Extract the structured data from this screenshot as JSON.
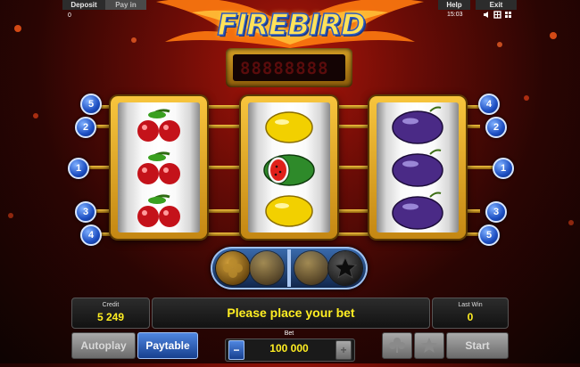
{
  "topbar": {
    "deposit_label": "Deposit",
    "payin_label": "Pay in",
    "deposit_value": "0",
    "help_label": "Help",
    "exit_label": "Exit",
    "time": "15:03"
  },
  "logo": {
    "title": "FIREBIRD"
  },
  "display": {
    "digits": "88888888"
  },
  "lines": {
    "left": [
      "5",
      "2",
      "1",
      "3",
      "4"
    ],
    "right": [
      "4",
      "2",
      "1",
      "3",
      "5"
    ]
  },
  "reels": [
    [
      "cherries",
      "cherries",
      "cherries"
    ],
    [
      "lemon",
      "watermelon",
      "lemon"
    ],
    [
      "plum",
      "plum",
      "plum"
    ]
  ],
  "credit": {
    "label": "Credit",
    "value": "5 249"
  },
  "message": "Please place your bet",
  "last_win": {
    "label": "Last Win",
    "value": "0"
  },
  "buttons": {
    "autoplay": "Autoplay",
    "paytable": "Paytable",
    "start": "Start"
  },
  "bet": {
    "label": "Bet",
    "value": "100 000",
    "minus": "−",
    "plus": "+"
  },
  "icons": {
    "sound": "speaker-icon",
    "fullscreen": "fullscreen-icon",
    "gamble_red": "clover-icon",
    "gamble_black": "star-icon"
  }
}
